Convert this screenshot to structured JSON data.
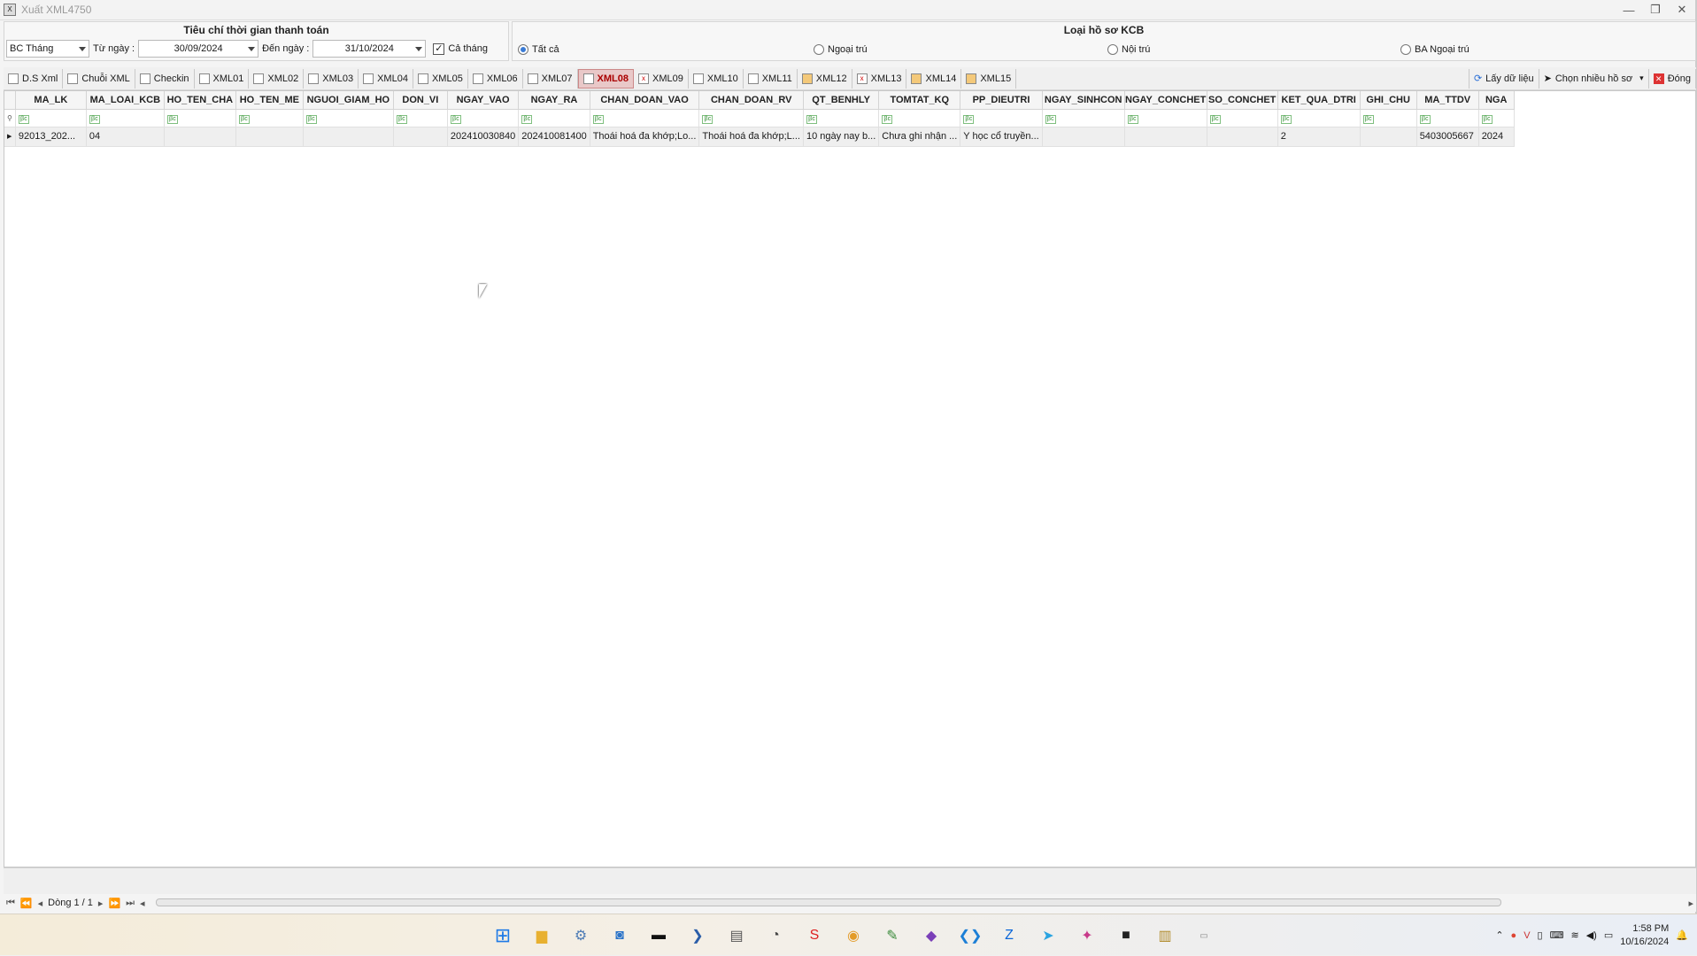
{
  "window": {
    "title": "Xuất XML4750",
    "min": "—",
    "restore": "❐",
    "close": "✕"
  },
  "criteria": {
    "group_title": "Tiêu chí thời gian thanh toán",
    "report_type": "BC Tháng",
    "from_label": "Từ ngày :",
    "from_value": "30/09/2024",
    "to_label": "Đến ngày :",
    "to_value": "31/10/2024",
    "whole_month_label": "Cả tháng",
    "whole_month_checked": true
  },
  "kcb": {
    "group_title": "Loại hồ sơ KCB",
    "options": [
      "Tất cả",
      "Ngoại trú",
      "Nội trú",
      "BA Ngoại trú"
    ],
    "selected": "Tất cả"
  },
  "toolbar": {
    "tabs": [
      "D.S Xml",
      "Chuỗi XML",
      "Checkin",
      "XML01",
      "XML02",
      "XML03",
      "XML04",
      "XML05",
      "XML06",
      "XML07",
      "XML08",
      "XML09",
      "XML10",
      "XML11",
      "XML12",
      "XML13",
      "XML14",
      "XML15"
    ],
    "active_tab": "XML08",
    "fetch_label": "Lấy dữ liệu",
    "multi_label": "Chọn nhiều hồ sơ",
    "close_label": "Đóng"
  },
  "grid": {
    "columns": [
      "MA_LK",
      "MA_LOAI_KCB",
      "HO_TEN_CHA",
      "HO_TEN_ME",
      "NGUOI_GIAM_HO",
      "DON_VI",
      "NGAY_VAO",
      "NGAY_RA",
      "CHAN_DOAN_VAO",
      "CHAN_DOAN_RV",
      "QT_BENHLY",
      "TOMTAT_KQ",
      "PP_DIEUTRI",
      "NGAY_SINHCON",
      "NGAY_CONCHET",
      "SO_CONCHET",
      "KET_QUA_DTRI",
      "GHI_CHU",
      "MA_TTDV",
      "NGA"
    ],
    "filter_icon": "ꞵc",
    "rows": [
      [
        "92013_202...",
        "04",
        "",
        "",
        "",
        "",
        "202410030840",
        "202410081400",
        "Thoái hoá đa khớp;Lo...",
        "Thoái hoá đa khớp;L...",
        "10 ngày nay b...",
        "Chưa ghi nhận ...",
        "Y học cổ truyền...",
        "",
        "",
        "",
        "2",
        "",
        "5403005667",
        "2024"
      ]
    ]
  },
  "nav": {
    "record_text": "Dòng 1 / 1"
  },
  "taskbar": {
    "time": "1:58 PM",
    "date": "10/16/2024"
  }
}
